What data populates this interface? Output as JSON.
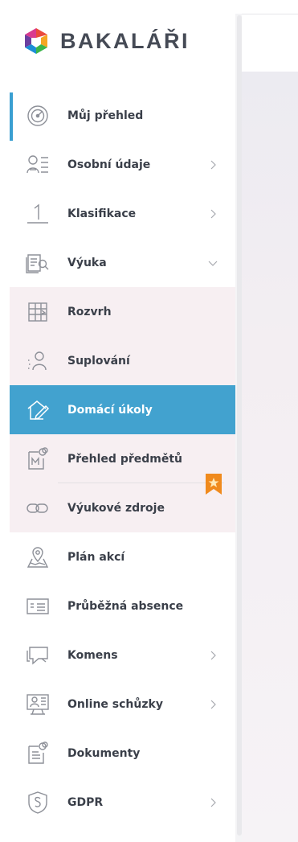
{
  "app": {
    "name": "BAKALÁŘI"
  },
  "colors": {
    "accent": "#42a2cf",
    "active_bar": "#3a9fd1",
    "submenu_bg": "#f7eff2",
    "bookmark": "#f08a1d",
    "text": "#3a3f49",
    "icon_stroke": "#8d9098"
  },
  "sidebar": {
    "items": [
      {
        "label": "Můj přehled",
        "icon": "dashboard-gauge-icon"
      },
      {
        "label": "Osobní údaje",
        "icon": "personal-data-icon"
      },
      {
        "label": "Klasifikace",
        "icon": "grade-one-icon"
      },
      {
        "label": "Výuka",
        "icon": "teaching-icon"
      },
      {
        "label": "Rozvrh",
        "icon": "timetable-icon"
      },
      {
        "label": "Suplování",
        "icon": "substitution-icon"
      },
      {
        "label": "Domácí úkoly",
        "icon": "homework-icon"
      },
      {
        "label": "Přehled předmětů",
        "icon": "subjects-overview-icon"
      },
      {
        "label": "Výukové zdroje",
        "icon": "link-chain-icon"
      },
      {
        "label": "Plán akcí",
        "icon": "events-map-icon"
      },
      {
        "label": "Průběžná absence",
        "icon": "absence-card-icon"
      },
      {
        "label": "Komens",
        "icon": "messages-icon"
      },
      {
        "label": "Online schůzky",
        "icon": "online-meeting-icon"
      },
      {
        "label": "Dokumenty",
        "icon": "documents-icon"
      },
      {
        "label": "GDPR",
        "icon": "gdpr-shield-icon"
      }
    ]
  }
}
